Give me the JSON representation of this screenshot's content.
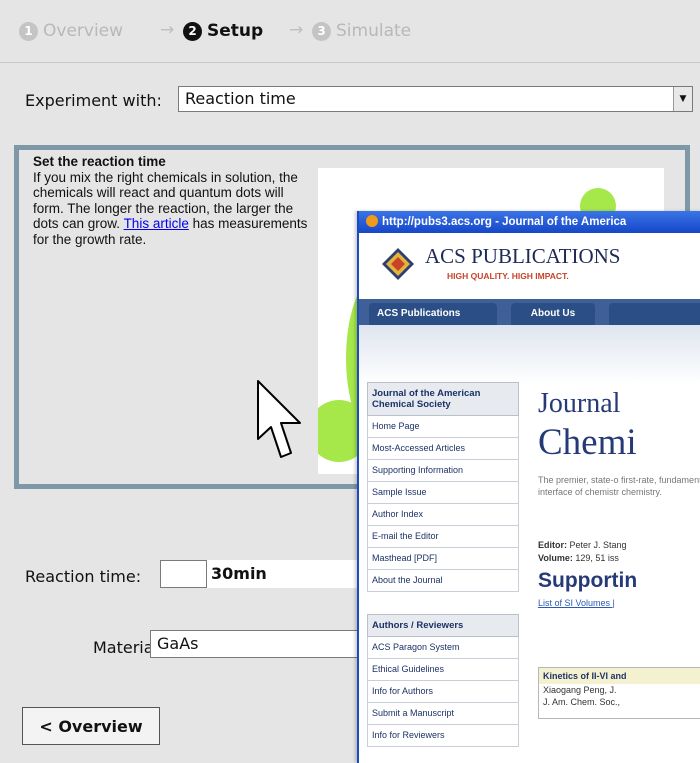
{
  "wizard": {
    "steps": [
      {
        "number": "1",
        "label": "Overview",
        "state": "inactive"
      },
      {
        "number": "2",
        "label": "Setup",
        "state": "active"
      },
      {
        "number": "3",
        "label": "Simulate",
        "state": "inactive"
      }
    ],
    "separator": "→"
  },
  "experiment": {
    "label": "Experiment with:",
    "selected": "Reaction time"
  },
  "info": {
    "heading": "Set the reaction time",
    "body_before_link": "If you mix the right chemicals in solution, the chemicals will react and quantum dots will form. The longer the reaction, the larger the dots can grow. ",
    "link_text": "This article",
    "body_after_link": " has measurements for the growth rate."
  },
  "controls": {
    "reaction_time_label": "Reaction time:",
    "reaction_time_input": "",
    "reaction_time_value": "30min",
    "material_label": "Material:",
    "material_selected": "GaAs"
  },
  "buttons": {
    "overview": "< Overview"
  },
  "browser": {
    "title": "http://pubs3.acs.org - Journal of the America",
    "publisher": "ACS PUBLICATIONS",
    "tagline": "HIGH QUALITY. HIGH IMPACT.",
    "nav_tabs": [
      "ACS Publications Home",
      "About Us"
    ],
    "sidebar_section1": {
      "heading": "Journal of the American Chemical Society",
      "items": [
        "Home Page",
        "Most-Accessed Articles",
        "Supporting Information",
        "Sample Issue",
        "Author Index",
        "E-mail the Editor",
        "Masthead [PDF]",
        "About the Journal"
      ]
    },
    "sidebar_section2": {
      "heading": "Authors / Reviewers",
      "items": [
        "ACS Paragon System",
        "Ethical Guidelines",
        "Info for Authors",
        "Submit a Manuscript",
        "Info for Reviewers"
      ]
    },
    "journal_title_line1": "Journal",
    "journal_title_line2": "Chemi",
    "blurb": "The premier, state-o first-rate, fundament interface of chemistr chemistry.",
    "editor_label": "Editor:",
    "editor_value": "Peter J. Stang",
    "volume_label": "Volume:",
    "volume_value": "129, 51 iss",
    "supporting_heading": "Supportin",
    "si_volumes_link": "List of SI Volumes |",
    "article": {
      "title": "Kinetics of II-VI and",
      "authors": "Xiaogang Peng, J. ",
      "citation": "J. Am. Chem. Soc.,"
    }
  },
  "colors": {
    "panel_border": "#7f98a8",
    "preview_blob": "#a6e84a",
    "link": "#0000ee",
    "titlebar": "#1547c8"
  }
}
